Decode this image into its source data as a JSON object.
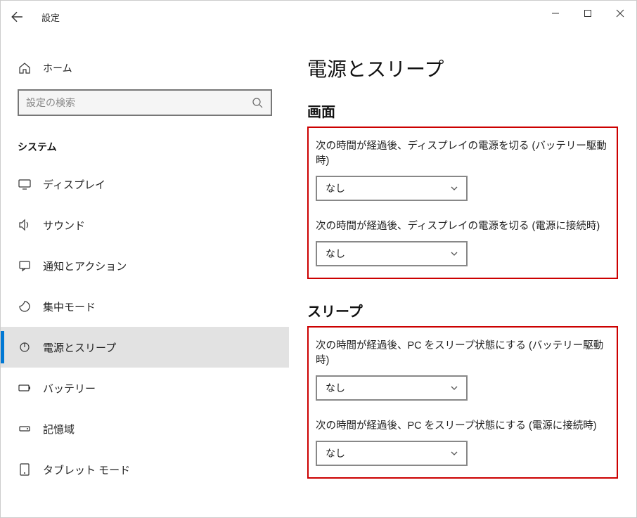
{
  "window": {
    "title": "設定"
  },
  "sidebar": {
    "home_label": "ホーム",
    "search_placeholder": "設定の検索",
    "category": "システム",
    "items": [
      {
        "icon": "display",
        "label": "ディスプレイ"
      },
      {
        "icon": "sound",
        "label": "サウンド"
      },
      {
        "icon": "notifications",
        "label": "通知とアクション"
      },
      {
        "icon": "focus",
        "label": "集中モード"
      },
      {
        "icon": "power",
        "label": "電源とスリープ"
      },
      {
        "icon": "battery",
        "label": "バッテリー"
      },
      {
        "icon": "storage",
        "label": "記憶域"
      },
      {
        "icon": "tablet",
        "label": "タブレット モード"
      }
    ]
  },
  "main": {
    "title": "電源とスリープ",
    "section_screen": "画面",
    "section_sleep": "スリープ",
    "settings": {
      "screen_battery_label": "次の時間が経過後、ディスプレイの電源を切る (バッテリー駆動時)",
      "screen_battery_value": "なし",
      "screen_plugged_label": "次の時間が経過後、ディスプレイの電源を切る (電源に接続時)",
      "screen_plugged_value": "なし",
      "sleep_battery_label": "次の時間が経過後、PC をスリープ状態にする (バッテリー駆動時)",
      "sleep_battery_value": "なし",
      "sleep_plugged_label": "次の時間が経過後、PC をスリープ状態にする (電源に接続時)",
      "sleep_plugged_value": "なし"
    }
  }
}
